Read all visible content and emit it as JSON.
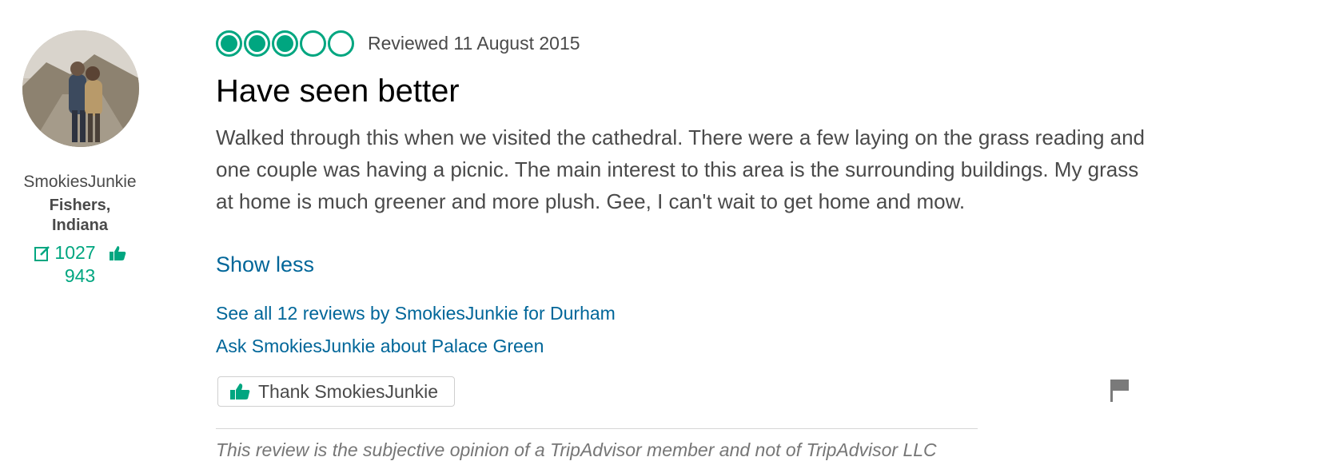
{
  "reviewer": {
    "username": "SmokiesJunkie",
    "location": "Fishers, Indiana",
    "review_count": "1027",
    "helpful_votes": "943"
  },
  "review": {
    "rating": 3,
    "rating_max": 5,
    "date_text": "Reviewed 11 August 2015",
    "title": "Have seen better",
    "body": "Walked through this when we visited the cathedral. There were a few laying on the grass reading and one couple was having a picnic. The main interest to this area is the surrounding buildings. My grass at home is much greener and more plush. Gee, I can't wait to get home and mow.",
    "show_less_label": "Show less",
    "see_all_link": "See all 12 reviews by SmokiesJunkie for Durham",
    "ask_link": "Ask SmokiesJunkie about Palace Green",
    "thank_button_label": "Thank SmokiesJunkie",
    "disclaimer": "This review is the subjective opinion of a TripAdvisor member and not of TripAdvisor LLC"
  },
  "colors": {
    "accent": "#00a680",
    "link": "#006699",
    "text": "#4a4a4a"
  },
  "icons": {
    "reviews": "edit-icon",
    "helpful": "thumbs-up-icon",
    "report": "flag-icon"
  }
}
